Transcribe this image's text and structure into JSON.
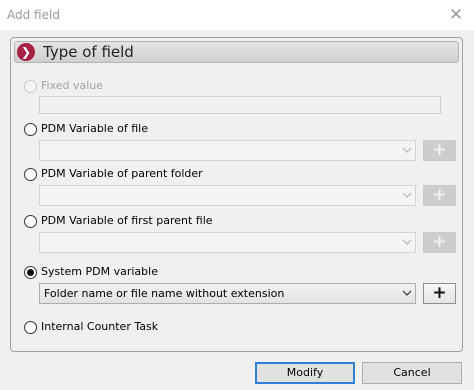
{
  "window": {
    "title": "Add field",
    "close_symbol": "✕",
    "close_icon": "close-icon"
  },
  "section": {
    "title": "Type of field",
    "icon": "chevron-right-icon",
    "accent_color": "#a62144",
    "icon_symbol": "❯"
  },
  "options": {
    "fixed_value": {
      "label": "Fixed value",
      "enabled": false,
      "checked": false,
      "value": ""
    },
    "file_variable": {
      "label": "PDM Variable of file",
      "enabled": true,
      "checked": false,
      "selected": "",
      "add_enabled": false
    },
    "parent_folder_variable": {
      "label": "PDM Variable of parent folder",
      "enabled": true,
      "checked": false,
      "selected": "",
      "add_enabled": false
    },
    "first_parent_file_variable": {
      "label": "PDM Variable of first parent file",
      "enabled": true,
      "checked": false,
      "selected": "",
      "add_enabled": false
    },
    "system_variable": {
      "label": "System PDM variable",
      "enabled": true,
      "checked": true,
      "selected": "Folder name or file name without extension",
      "add_enabled": true
    },
    "internal_counter": {
      "label": "Internal Counter Task",
      "enabled": true,
      "checked": false
    }
  },
  "add_button_symbol": "+",
  "buttons": {
    "modify": "Modify",
    "cancel": "Cancel"
  },
  "colors": {
    "focus_border": "#2f7fd6"
  }
}
